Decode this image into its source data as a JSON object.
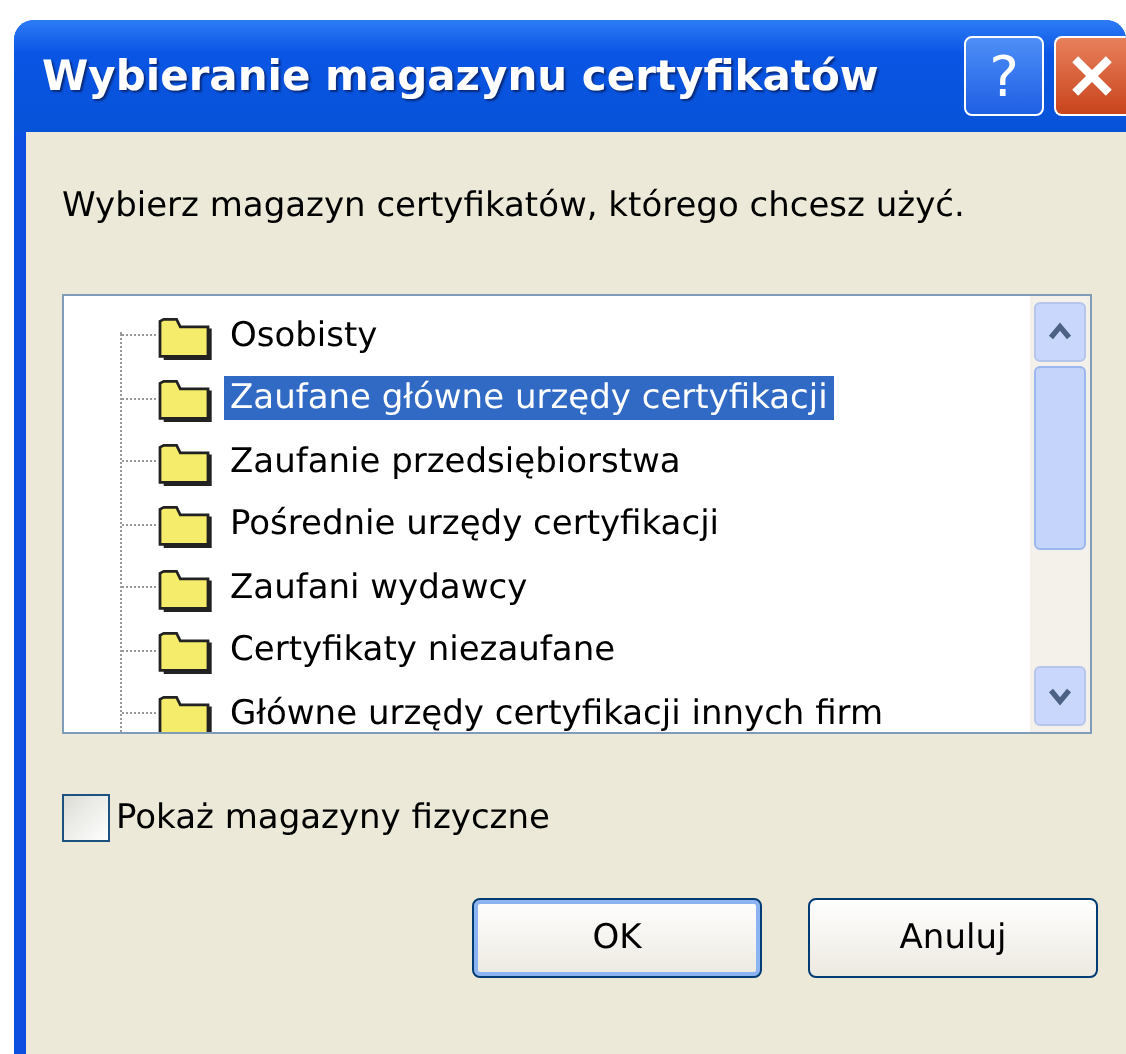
{
  "window": {
    "title": "Wybieranie magazynu certyfikatów",
    "help_button": "?"
  },
  "prompt": "Wybierz magazyn certyfikatów, którego chcesz użyć.",
  "stores": [
    {
      "label": "Osobisty",
      "selected": false
    },
    {
      "label": "Zaufane główne urzędy certyfikacji",
      "selected": true
    },
    {
      "label": "Zaufanie przedsiębiorstwa",
      "selected": false
    },
    {
      "label": "Pośrednie urzędy certyfikacji",
      "selected": false
    },
    {
      "label": "Zaufani wydawcy",
      "selected": false
    },
    {
      "label": "Certyfikaty niezaufane",
      "selected": false
    },
    {
      "label": "Główne urzędy certyfikacji innych firm",
      "selected": false
    }
  ],
  "show_physical": {
    "label": "Pokaż magazyny fizyczne",
    "checked": false
  },
  "buttons": [
    {
      "label": "OK",
      "default": true
    },
    {
      "label": "Anuluj",
      "default": false
    }
  ]
}
